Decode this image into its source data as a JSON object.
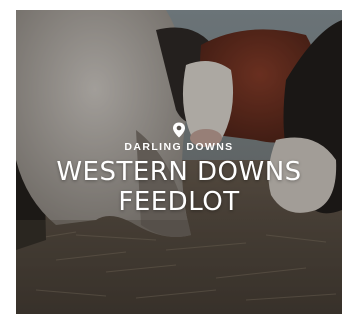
{
  "card": {
    "region": "DARLING DOWNS",
    "title_line_1": "WESTERN DOWNS",
    "title_line_2": "FEEDLOT"
  },
  "icons": {
    "location": "map-pin-icon"
  },
  "colors": {
    "text": "#ffffff",
    "overlay": "#141210"
  }
}
